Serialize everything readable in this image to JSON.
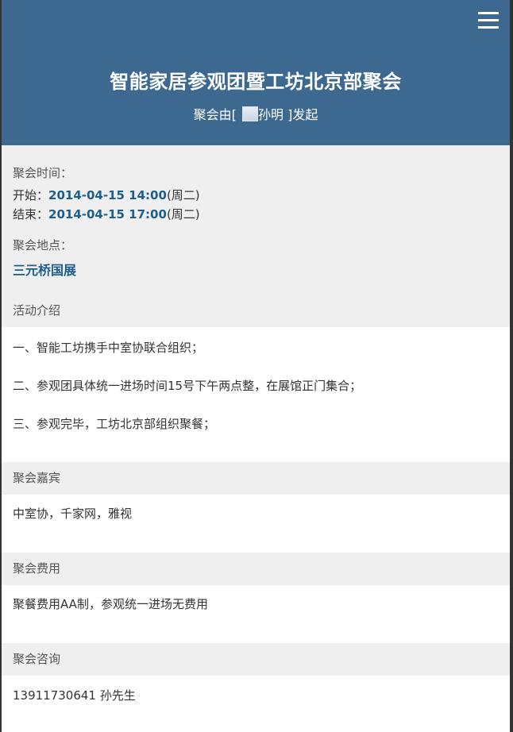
{
  "header": {
    "title": "智能家居参观团暨工坊北京部聚会",
    "subtitle_prefix": "聚会由[ ",
    "organizer": "孙明",
    "subtitle_suffix": " ]发起",
    "menu_icon": "hamburger-menu-icon",
    "bg_color": "#3d6890"
  },
  "time": {
    "label": "聚会时间：",
    "start_label": "开始：",
    "start_value": "2014-04-15 14:00",
    "start_day": "(周二)",
    "end_label": "结束：",
    "end_value": "2014-04-15 17:00",
    "end_day": "(周二)"
  },
  "location": {
    "label": "聚会地点：",
    "value": "三元桥国展"
  },
  "intro": {
    "title": "活动介绍",
    "items": [
      "一、智能工坊携手中室协联合组织；",
      "二、参观团具体统一进场时间15号下午两点整，在展馆正门集合；",
      "三、参观完毕，工坊北京部组织聚餐；"
    ]
  },
  "guests": {
    "title": "聚会嘉宾",
    "value": "中室协，千家网，雅视"
  },
  "fee": {
    "title": "聚会费用",
    "value": "聚餐费用AA制，参观统一进场无费用"
  },
  "consult": {
    "title": "聚会咨询",
    "value": "13911730641 孙先生"
  }
}
